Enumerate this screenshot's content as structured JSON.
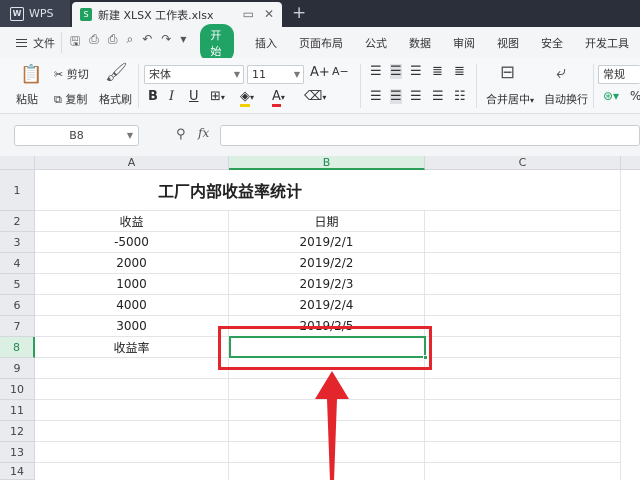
{
  "titlebar": {
    "app_name": "WPS",
    "doc_tab_title": "新建 XLSX 工作表.xlsx",
    "new_tab_symbol": "+"
  },
  "menubar": {
    "file": "文件",
    "start_button": "开始",
    "items": [
      "插入",
      "页面布局",
      "公式",
      "数据",
      "审阅",
      "视图",
      "安全",
      "开发工具"
    ]
  },
  "ribbon": {
    "paste": "粘贴",
    "cut": "剪切",
    "copy": "复制",
    "format_painter": "格式刷",
    "font_name": "宋体",
    "font_size": "11",
    "merge_center": "合并居中",
    "wrap_text": "自动换行",
    "number_format": "常规",
    "grow_font": "A+",
    "shrink_font": "A−",
    "bold": "B",
    "italic": "I",
    "underline": "U",
    "font_color": "A",
    "percent": "%",
    "fill_color_hex": "#f5d000",
    "font_color_hex": "#e3262b"
  },
  "formula_bar": {
    "name_box": "B8",
    "fx": "fx",
    "formula": ""
  },
  "sheet": {
    "columns": [
      "A",
      "B",
      "C"
    ],
    "active_column": "B",
    "active_row": "8",
    "row_numbers": [
      "1",
      "2",
      "3",
      "4",
      "5",
      "6",
      "7",
      "8",
      "9",
      "10",
      "11",
      "12",
      "13",
      "14"
    ],
    "title": "工厂内部收益率统计",
    "rows": [
      {
        "a": "收益",
        "b": "日期"
      },
      {
        "a": "-5000",
        "b": "2019/2/1"
      },
      {
        "a": "2000",
        "b": "2019/2/2"
      },
      {
        "a": "1000",
        "b": "2019/2/3"
      },
      {
        "a": "4000",
        "b": "2019/2/4"
      },
      {
        "a": "3000",
        "b": "2019/2/5"
      },
      {
        "a": "收益率",
        "b": ""
      }
    ]
  },
  "annotation": {
    "color_hex": "#e3262b"
  }
}
